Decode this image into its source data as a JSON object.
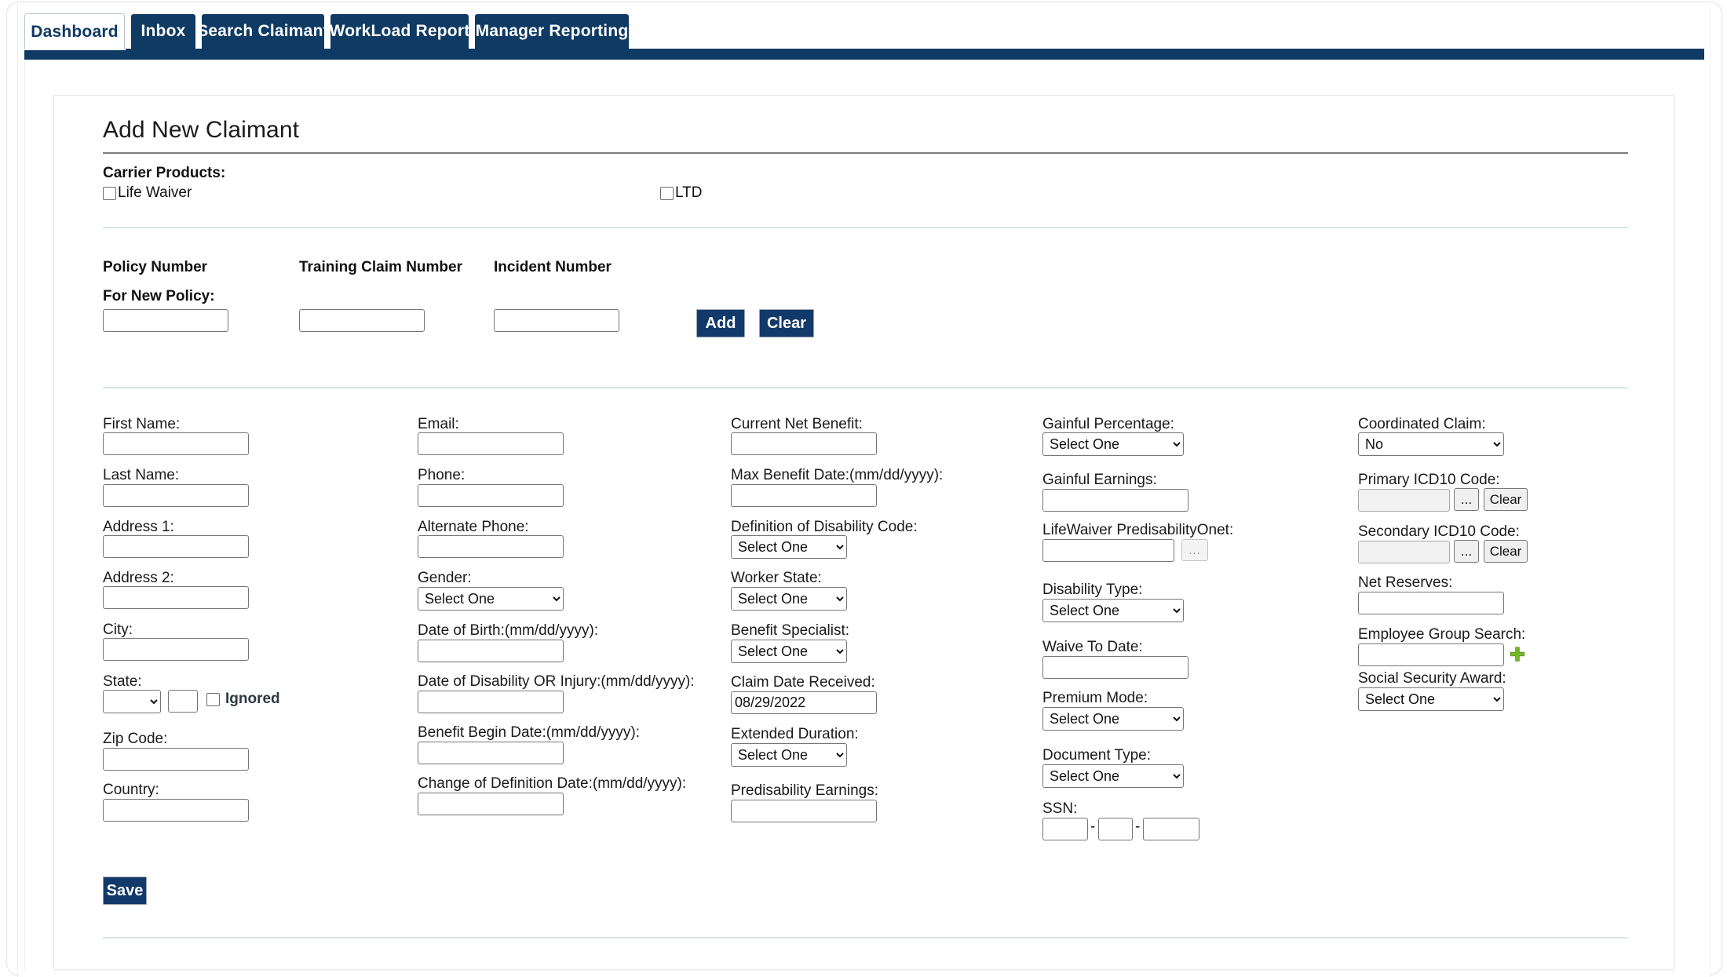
{
  "nav": {
    "tabs": [
      {
        "label": "Dashboard",
        "active": true
      },
      {
        "label": "Inbox",
        "active": false
      },
      {
        "label": "Search Claimant",
        "active": false
      },
      {
        "label": "WorkLoad Report",
        "active": false
      },
      {
        "label": "Manager Reporting",
        "active": false
      }
    ]
  },
  "page": {
    "title": "Add New Claimant"
  },
  "carrier_products": {
    "label": "Carrier Products:",
    "options": [
      {
        "label": "Life Waiver",
        "checked": false
      },
      {
        "label": "LTD",
        "checked": false
      }
    ]
  },
  "policy_section": {
    "headers": {
      "policy_number": "Policy Number",
      "training_claim_number": "Training Claim Number",
      "incident_number": "Incident Number"
    },
    "for_new_policy_label": "For New Policy:",
    "policy_number_value": "",
    "training_claim_number_value": "",
    "incident_number_value": "",
    "add_label": "Add",
    "clear_label": "Clear"
  },
  "form": {
    "col1": {
      "first_name": {
        "label": "First Name:",
        "value": ""
      },
      "last_name": {
        "label": "Last Name:",
        "value": ""
      },
      "address1": {
        "label": "Address 1:",
        "value": ""
      },
      "address2": {
        "label": "Address 2:",
        "value": ""
      },
      "city": {
        "label": "City:",
        "value": ""
      },
      "state": {
        "label": "State:",
        "value": "",
        "extra_value": "",
        "ignored_label": "Ignored",
        "ignored_checked": false
      },
      "zip_code": {
        "label": "Zip Code:",
        "value": ""
      },
      "country": {
        "label": "Country:",
        "value": ""
      }
    },
    "col2": {
      "email": {
        "label": "Email:",
        "value": ""
      },
      "phone": {
        "label": "Phone:",
        "value": ""
      },
      "alternate_phone": {
        "label": "Alternate Phone:",
        "value": ""
      },
      "gender": {
        "label": "Gender:",
        "value": "Select One"
      },
      "date_of_birth": {
        "label": "Date of Birth:(mm/dd/yyyy):",
        "value": ""
      },
      "date_of_disability": {
        "label": "Date of Disability OR Injury:(mm/dd/yyyy):",
        "value": ""
      },
      "benefit_begin_date": {
        "label": "Benefit Begin Date:(mm/dd/yyyy):",
        "value": ""
      },
      "change_of_definition_date": {
        "label": "Change of Definition Date:(mm/dd/yyyy):",
        "value": ""
      }
    },
    "col3": {
      "current_net_benefit": {
        "label": "Current Net Benefit:",
        "value": ""
      },
      "max_benefit_date": {
        "label": "Max Benefit Date:(mm/dd/yyyy):",
        "value": ""
      },
      "definition_of_disability_code": {
        "label": "Definition of Disability Code:",
        "value": "Select One"
      },
      "worker_state": {
        "label": "Worker State:",
        "value": "Select One"
      },
      "benefit_specialist": {
        "label": "Benefit Specialist:",
        "value": "Select One"
      },
      "claim_date_received": {
        "label": "Claim Date Received:",
        "value": "08/29/2022"
      },
      "extended_duration": {
        "label": "Extended Duration:",
        "value": "Select One"
      },
      "predisability_earnings": {
        "label": "Predisability Earnings:",
        "value": ""
      }
    },
    "col4": {
      "gainful_percentage": {
        "label": "Gainful Percentage:",
        "value": "Select One"
      },
      "gainful_earnings": {
        "label": "Gainful Earnings:",
        "value": ""
      },
      "lifewaiver_predisability_onet": {
        "label": "LifeWaiver PredisabilityOnet:",
        "value": "",
        "picker_label": "..."
      },
      "disability_type": {
        "label": "Disability Type:",
        "value": "Select One"
      },
      "waive_to_date": {
        "label": "Waive To Date:",
        "value": ""
      },
      "premium_mode": {
        "label": "Premium Mode:",
        "value": "Select One"
      },
      "document_type": {
        "label": "Document Type:",
        "value": "Select One"
      },
      "ssn": {
        "label": "SSN:",
        "part1": "",
        "part2": "",
        "part3": "",
        "separator": "-"
      }
    },
    "col5": {
      "coordinated_claim": {
        "label": "Coordinated Claim:",
        "value": "No"
      },
      "primary_icd10": {
        "label": "Primary ICD10 Code:",
        "value": "",
        "picker_label": "...",
        "clear_label": "Clear"
      },
      "secondary_icd10": {
        "label": "Secondary ICD10 Code:",
        "value": "",
        "picker_label": "...",
        "clear_label": "Clear"
      },
      "net_reserves": {
        "label": "Net Reserves:",
        "value": ""
      },
      "employee_group_search": {
        "label": "Employee Group Search:",
        "value": "",
        "add_icon": "plus-icon"
      },
      "social_security_award": {
        "label": "Social Security Award:",
        "value": "Select One"
      }
    }
  },
  "actions": {
    "save_label": "Save"
  },
  "colors": {
    "navy": "#0f3a63",
    "button_navy": "#11396a",
    "green_plus": "#76b82a",
    "rule_light": "#d9e5e5",
    "rule_dark": "#7b7b7b"
  }
}
